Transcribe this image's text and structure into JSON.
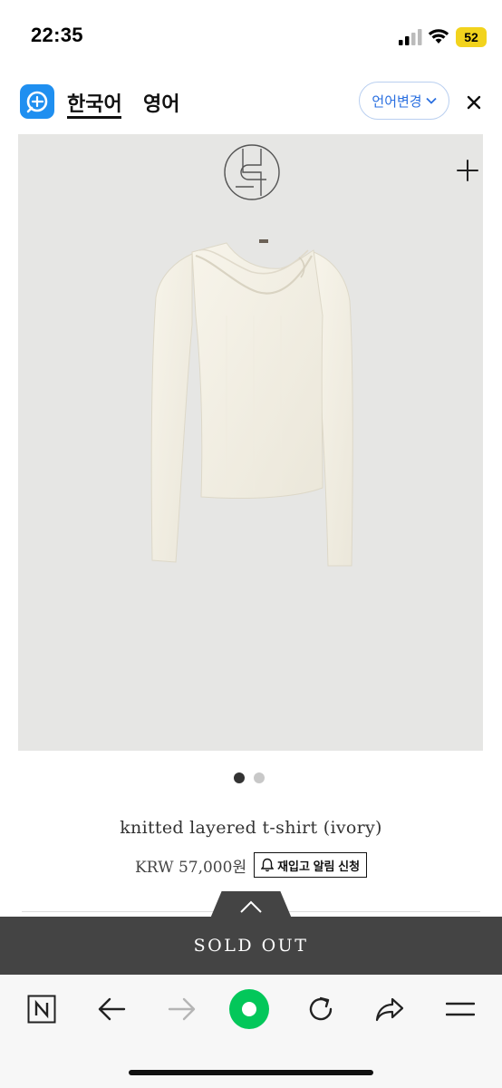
{
  "status_bar": {
    "time": "22:35",
    "battery": "52"
  },
  "translate_bar": {
    "lang_source": "한국어",
    "lang_target": "영어",
    "change_button": "언어변경"
  },
  "product": {
    "name": "knitted layered t-shirt (ivory)",
    "price": "KRW 57,000원",
    "restock_button": "재입고 알림 신청",
    "image_count": 2,
    "active_image": 1
  },
  "sold_out_label": "SOLD OUT",
  "colors": {
    "accent_blue": "#1f8ff0",
    "sold_out_bg": "#444444",
    "naver_green": "#03c75a",
    "battery": "#f2d31d"
  }
}
